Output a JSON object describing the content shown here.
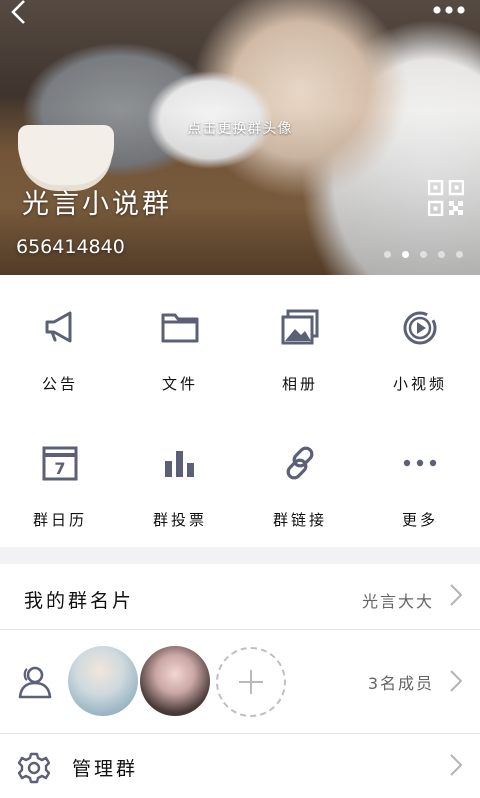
{
  "header": {
    "back_icon": "chevron-left-icon",
    "menu_icon": "more-dots-icon",
    "avatar_hint": "点击更换群头像",
    "group_name": "光言小说群",
    "group_number": "656414840",
    "qr_icon": "qr-code-icon",
    "carousel_pages": 5,
    "carousel_active": 1
  },
  "grid": {
    "items": [
      {
        "label": "公告",
        "icon": "megaphone-icon"
      },
      {
        "label": "文件",
        "icon": "folder-icon"
      },
      {
        "label": "相册",
        "icon": "album-icon"
      },
      {
        "label": "小视频",
        "icon": "video-icon"
      },
      {
        "label": "群日历",
        "icon": "calendar-icon"
      },
      {
        "label": "群投票",
        "icon": "vote-chart-icon"
      },
      {
        "label": "群链接",
        "icon": "link-icon"
      },
      {
        "label": "更多",
        "icon": "more-icon"
      }
    ],
    "calendar_day": "7"
  },
  "card": {
    "title": "我的群名片",
    "value": "光言大大"
  },
  "members": {
    "count_text": "3名成员"
  },
  "manage": {
    "title": "管理群"
  },
  "colors": {
    "icon": "#5b6076",
    "divider": "#e4e4e6",
    "background": "#f2f2f4"
  }
}
